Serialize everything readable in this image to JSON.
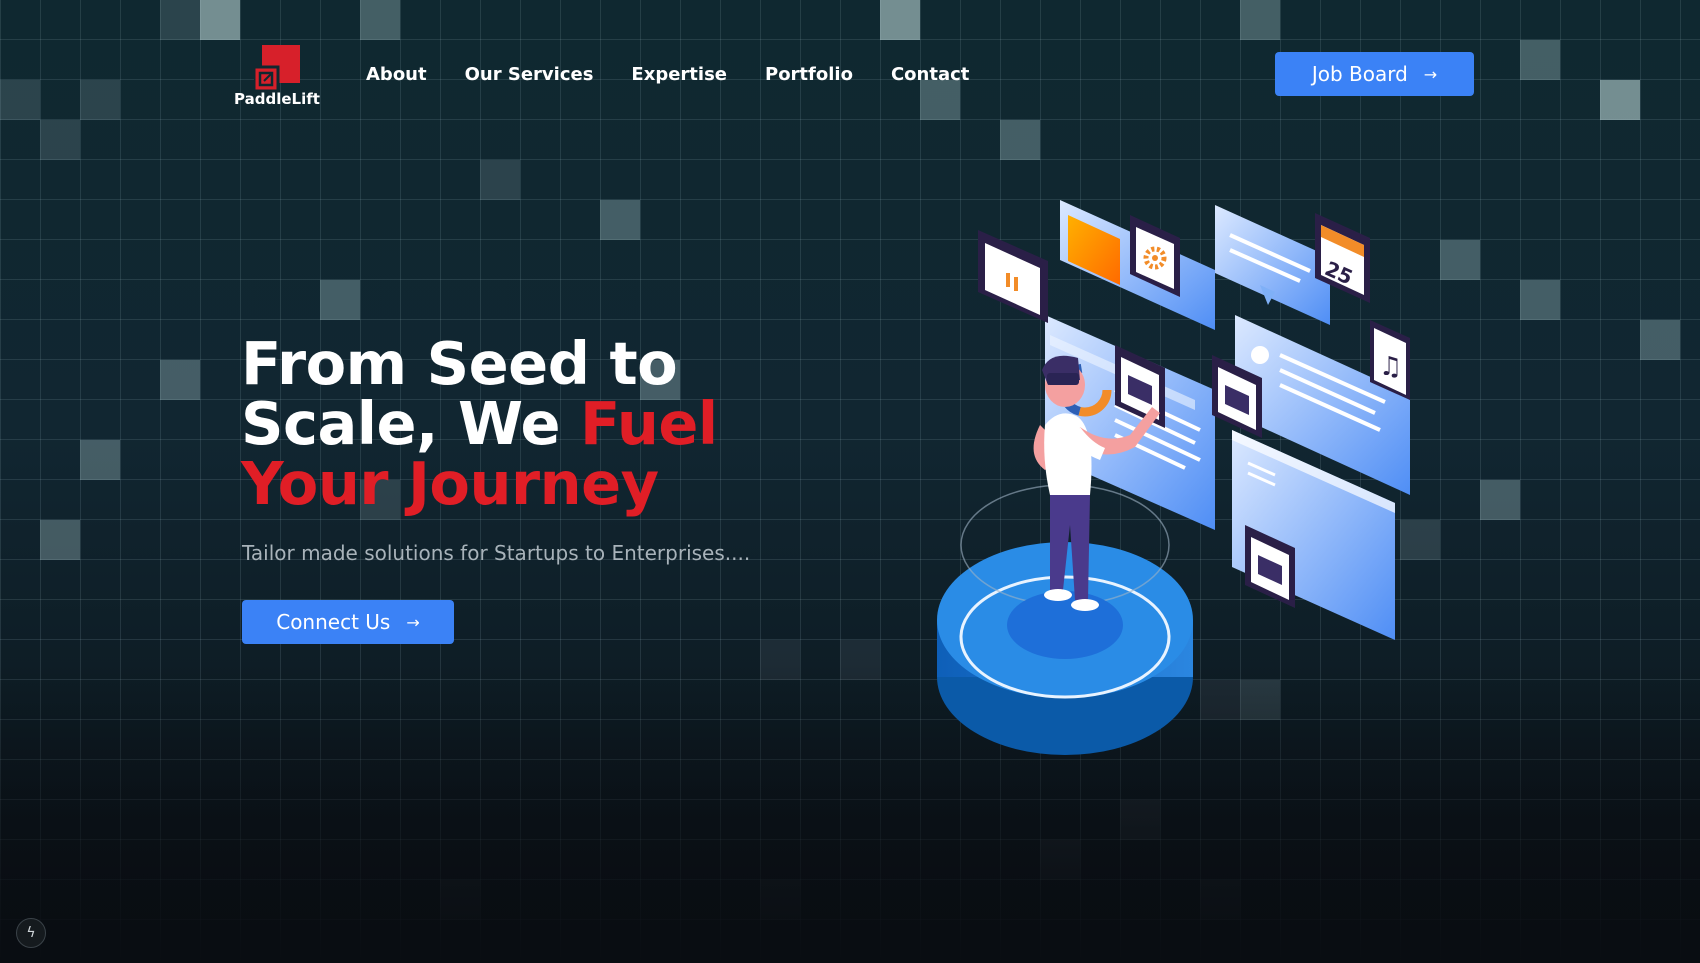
{
  "brand": {
    "name": "PaddleLift",
    "accent": "#e01e26",
    "primary": "#3b82f6"
  },
  "nav": [
    {
      "label": "About"
    },
    {
      "label": "Our Services"
    },
    {
      "label": "Expertise"
    },
    {
      "label": "Portfolio"
    },
    {
      "label": "Contact"
    }
  ],
  "header": {
    "job_board_label": "Job Board",
    "arrow_icon": "arrow-right-icon"
  },
  "hero": {
    "headline_white_1": "From Seed to",
    "headline_white_2": "Scale, We",
    "headline_red_1": "Fuel",
    "headline_red_2": "Your Journey",
    "subtitle": "Tailor made solutions for Startups to Enterprises....",
    "cta_label": "Connect Us"
  },
  "illustration": {
    "calendar_day": "25"
  },
  "floating_button": {
    "icon": "lightning-bolt-icon"
  }
}
